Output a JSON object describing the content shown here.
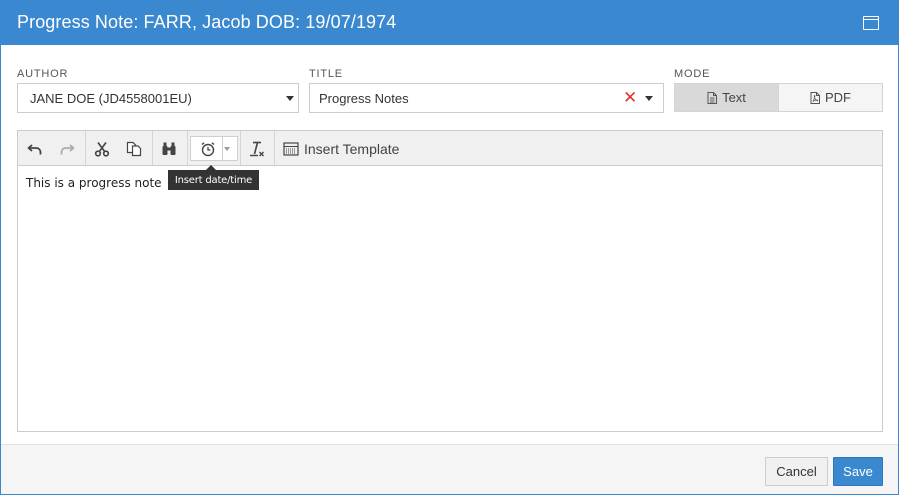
{
  "dialog": {
    "title": "Progress Note: FARR, Jacob DOB: 19/07/1974",
    "accent_color": "#3a88cf",
    "maximize_icon": "maximize-icon"
  },
  "author": {
    "label": "AUTHOR",
    "value": "JANE DOE (JD4558001EU)"
  },
  "title_field": {
    "label": "TITLE",
    "value": "Progress Notes",
    "clear_glyph": "✕"
  },
  "mode": {
    "label": "MODE",
    "options": [
      {
        "label": "Text",
        "icon": "document-icon",
        "selected": true
      },
      {
        "label": "PDF",
        "icon": "pdf-icon",
        "selected": false
      }
    ]
  },
  "toolbar": {
    "buttons": [
      {
        "name": "undo",
        "icon": "undo-icon"
      },
      {
        "name": "redo",
        "icon": "redo-icon"
      },
      {
        "name": "cut",
        "icon": "scissors-icon"
      },
      {
        "name": "copy",
        "icon": "copy-icon"
      },
      {
        "name": "find",
        "icon": "binoculars-icon"
      },
      {
        "name": "insert-datetime",
        "icon": "clock-icon"
      },
      {
        "name": "clear-formatting",
        "icon": "clear-format-icon"
      }
    ],
    "insert_template_label": "Insert Template"
  },
  "editor": {
    "content": "This is a progress note"
  },
  "tooltip": {
    "text": "Insert date/time"
  },
  "footer": {
    "cancel_label": "Cancel",
    "save_label": "Save"
  }
}
